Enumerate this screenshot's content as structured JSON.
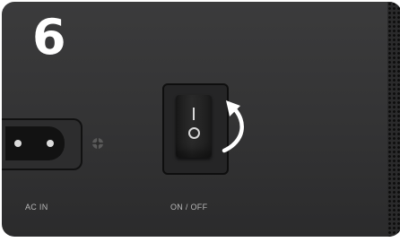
{
  "step": {
    "number": "6"
  },
  "panel": {
    "ac_label": "AC IN",
    "switch_label": "ON / OFF",
    "rocker_on_symbol": "I",
    "rocker_off_symbol": "O"
  },
  "icons": {
    "ground": "ground-symbol-icon",
    "arrow": "curved-arrow-icon"
  },
  "colors": {
    "panel": "#363637",
    "text": "#ffffff",
    "label": "#b8b8b8"
  }
}
